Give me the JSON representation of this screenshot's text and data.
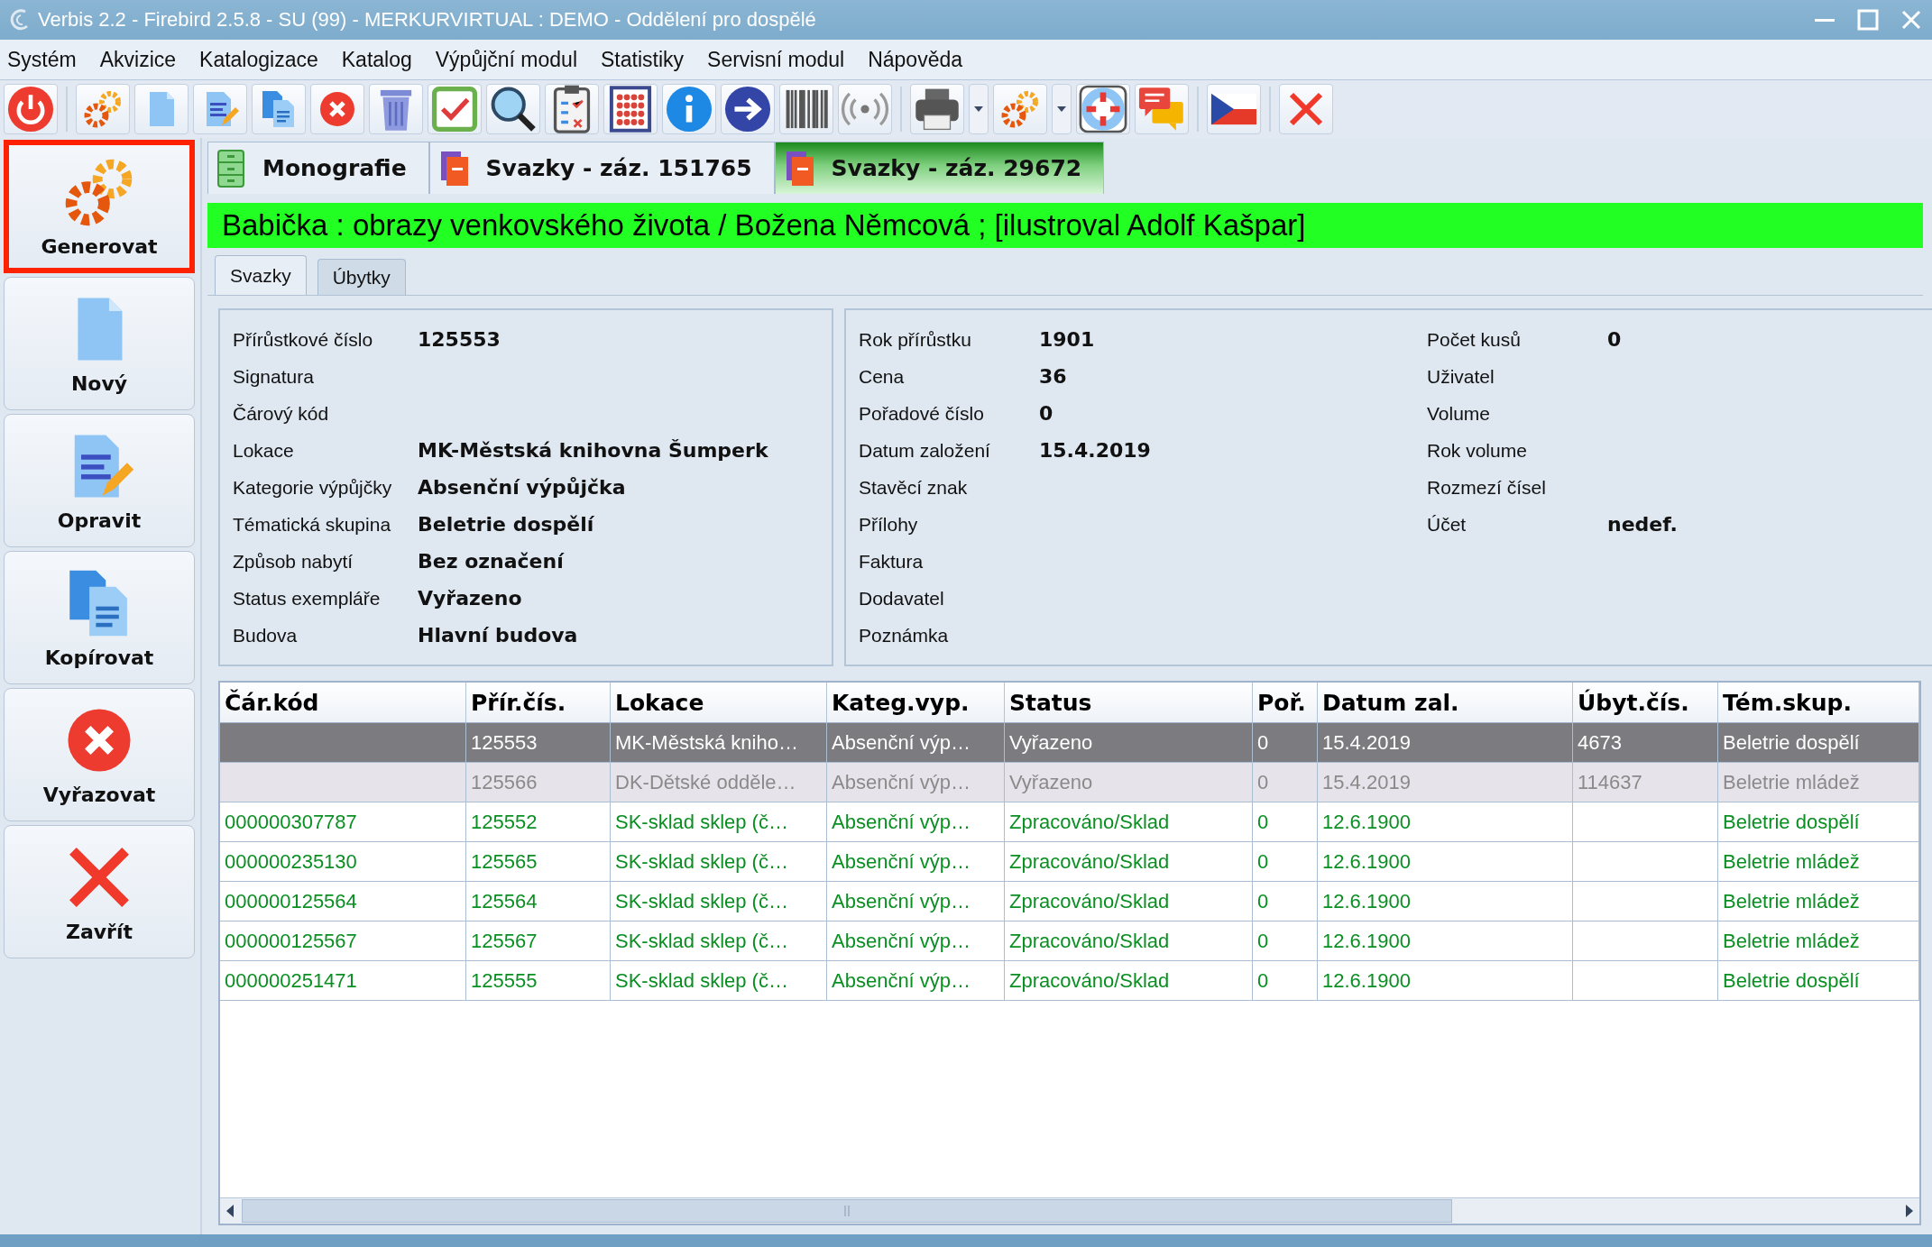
{
  "window": {
    "title": "Verbis 2.2 - Firebird 2.5.8 - SU (99) - MERKURVIRTUAL : DEMO - Oddělení pro dospělé"
  },
  "menu": [
    "Systém",
    "Akvizice",
    "Katalogizace",
    "Katalog",
    "Výpůjční modul",
    "Statistiky",
    "Servisní modul",
    "Nápověda"
  ],
  "sidebar": {
    "items": [
      {
        "label": "Generovat",
        "selected": true
      },
      {
        "label": "Nový",
        "selected": false
      },
      {
        "label": "Opravit",
        "selected": false
      },
      {
        "label": "Kopírovat",
        "selected": false
      },
      {
        "label": "Vyřazovat",
        "selected": false
      },
      {
        "label": "Zavřít",
        "selected": false
      }
    ]
  },
  "tabs": [
    {
      "label": "Monografie",
      "selected": false
    },
    {
      "label": "Svazky - záz. 151765",
      "selected": false
    },
    {
      "label": "Svazky - záz. 29672",
      "selected": true
    }
  ],
  "record_title": "Babička : obrazy venkovského života / Božena Němcová ; [ilustroval Adolf Kašpar]",
  "subtabs": [
    {
      "label": "Svazky",
      "selected": true
    },
    {
      "label": "Úbytky",
      "selected": false
    }
  ],
  "details": [
    [
      {
        "label": "Přírůstkové číslo",
        "value": "125553"
      },
      {
        "label": "Signatura"
      },
      {
        "label": "Čárový kód"
      },
      {
        "label": "Lokace",
        "value": "MK-Městská knihovna Šumperk"
      },
      {
        "label": "Kategorie výpůjčky",
        "value": "Absenční výpůjčka"
      },
      {
        "label": "Tématická skupina",
        "value": "Beletrie dospělí"
      },
      {
        "label": "Způsob nabytí",
        "value": "Bez označení"
      },
      {
        "label": "Status exempláře",
        "value": "Vyřazeno"
      },
      {
        "label": "Budova",
        "value": "Hlavní budova"
      }
    ],
    [
      {
        "label": "Rok přírůstku",
        "value": "1901"
      },
      {
        "label": "Cena",
        "value": "36"
      },
      {
        "label": "Pořadové číslo",
        "value": "0"
      },
      {
        "label": "Datum založení",
        "value": "15.4.2019"
      },
      {
        "label": "Stavěcí znak"
      },
      {
        "label": "Přílohy"
      },
      {
        "label": "Faktura"
      },
      {
        "label": "Dodavatel"
      },
      {
        "label": "Poznámka"
      }
    ],
    [
      {
        "label": "Počet kusů",
        "value": "0"
      },
      {
        "label": "Uživatel"
      },
      {
        "label": "Volume"
      },
      {
        "label": "Rok volume"
      },
      {
        "label": "Rozmezí čísel"
      },
      {
        "label": "Účet",
        "value": "nedef."
      }
    ]
  ],
  "table": {
    "columns": [
      "Čár.kód",
      "Přír.čís.",
      "Lokace",
      "Kateg.vyp.",
      "Status",
      "Poř.",
      "Datum zal.",
      "Úbyt.čís.",
      "Tém.skup."
    ],
    "rows": [
      {
        "selected": true,
        "discarded": true,
        "cells": [
          "",
          "125553",
          "MK-Městská kniho…",
          "Absenční výp…",
          "Vyřazeno",
          "0",
          "15.4.2019",
          "4673",
          "Beletrie dospělí"
        ]
      },
      {
        "selected": false,
        "discarded": true,
        "cells": [
          "",
          "125566",
          "DK-Dětské odděle…",
          "Absenční výp…",
          "Vyřazeno",
          "0",
          "15.4.2019",
          "114637",
          "Beletrie mládež"
        ]
      },
      {
        "selected": false,
        "discarded": false,
        "cells": [
          "000000307787",
          "125552",
          "SK-sklad sklep (č…",
          "Absenční výp…",
          "Zpracováno/Sklad",
          "0",
          "12.6.1900",
          "",
          "Beletrie dospělí"
        ]
      },
      {
        "selected": false,
        "discarded": false,
        "cells": [
          "000000235130",
          "125565",
          "SK-sklad sklep (č…",
          "Absenční výp…",
          "Zpracováno/Sklad",
          "0",
          "12.6.1900",
          "",
          "Beletrie mládež"
        ]
      },
      {
        "selected": false,
        "discarded": false,
        "cells": [
          "000000125564",
          "125564",
          "SK-sklad sklep (č…",
          "Absenční výp…",
          "Zpracováno/Sklad",
          "0",
          "12.6.1900",
          "",
          "Beletrie mládež"
        ]
      },
      {
        "selected": false,
        "discarded": false,
        "cells": [
          "000000125567",
          "125567",
          "SK-sklad sklep (č…",
          "Absenční výp…",
          "Zpracováno/Sklad",
          "0",
          "12.6.1900",
          "",
          "Beletrie mládež"
        ]
      },
      {
        "selected": false,
        "discarded": false,
        "cells": [
          "000000251471",
          "125555",
          "SK-sklad sklep (č…",
          "Absenční výp…",
          "Zpracováno/Sklad",
          "0",
          "12.6.1900",
          "",
          "Beletrie dospělí"
        ]
      }
    ]
  }
}
